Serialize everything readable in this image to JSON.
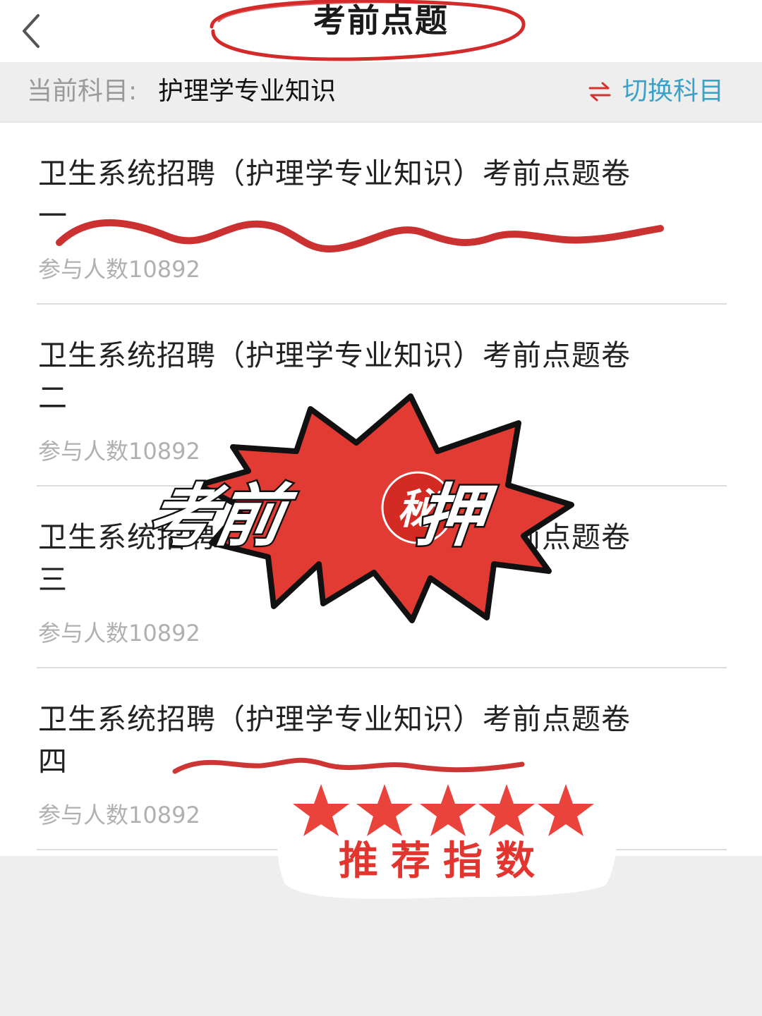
{
  "header": {
    "title": "考前点题"
  },
  "subject_bar": {
    "label": "当前科目:",
    "value": "护理学专业知识",
    "switch_label": "切换科目"
  },
  "papers": [
    {
      "title": "卫生系统招聘（护理学专业知识）考前点题卷一",
      "count": "参与人数10892"
    },
    {
      "title": "卫生系统招聘（护理学专业知识）考前点题卷二",
      "count": "参与人数10892"
    },
    {
      "title": "卫生系统招聘（护理学专业知识）考前点题卷三",
      "count": "参与人数10892"
    },
    {
      "title": "卫生系统招聘（护理学专业知识）考前点题卷四",
      "count": "参与人数10892"
    }
  ],
  "sticker": {
    "burst_text_1": "考前",
    "burst_badge": "秘",
    "burst_text_2": "押",
    "rating_label": "推荐指数",
    "rating_stars": 5
  },
  "colors": {
    "accent_red": "#d8302c",
    "switch_blue": "#3aa2c8",
    "burst_red": "#e23b33"
  },
  "icons": {
    "back": "chevron-left-icon",
    "switch": "swap-arrows-icon"
  }
}
